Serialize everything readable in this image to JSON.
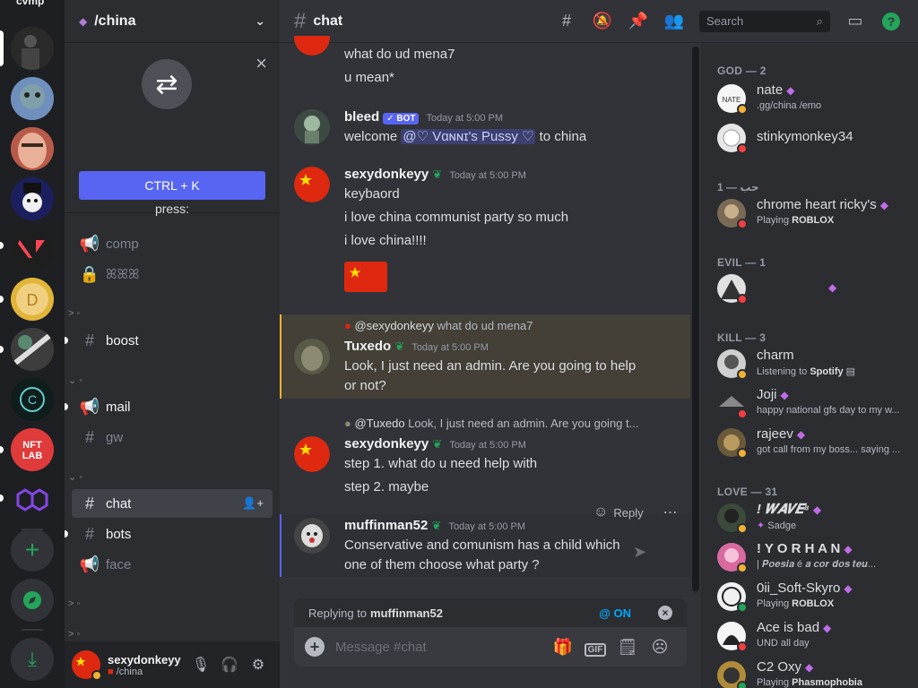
{
  "rail": {
    "top_name": "cvmp"
  },
  "guild": {
    "name": "/china",
    "quick_switcher": {
      "message": "Use Quick Switcher to get around Discord quickly. Just press:",
      "shortcut": "CTRL + K"
    }
  },
  "channels": [
    {
      "name": "comp",
      "icon": "megaphone-icon"
    },
    {
      "name": "ꕤꕤꕤ",
      "icon": "lock-icon"
    },
    {
      "name": "boost",
      "icon": "hash-icon"
    },
    {
      "name": "mail",
      "icon": "megaphone-icon"
    },
    {
      "name": "gw",
      "icon": "hash-icon"
    },
    {
      "name": "chat",
      "icon": "hash-icon"
    },
    {
      "name": "bots",
      "icon": "hash-icon"
    },
    {
      "name": "face",
      "icon": "megaphone-icon"
    }
  ],
  "categories": [
    "> ◦",
    "⌄ ◦",
    "⌄ ◦",
    "> ◦",
    "> ◦"
  ],
  "user_panel": {
    "username": "sexydonkeyy",
    "status": "/china"
  },
  "chat": {
    "channel": "chat",
    "search_placeholder": "Search",
    "messages": {
      "m0": {
        "line1": "what do ud mena7",
        "line2": "u mean*"
      },
      "m1": {
        "author": "bleed",
        "badge": "✓ BOT",
        "time": "Today at 5:00 PM",
        "pre": "welcome",
        "mention": "@♡ Vɑɴɴɪ's Pussy ♡",
        "post": "to china"
      },
      "m2": {
        "author": "sexydonkeyy",
        "time": "Today at 5:00 PM",
        "lines": [
          "keybaord",
          "i love china communist party so much",
          "i love china!!!!"
        ]
      },
      "m3": {
        "reply_author": "@sexydonkeyy",
        "reply_text": "what do ud mena7",
        "author": "Tuxedo",
        "time": "Today at 5:00 PM",
        "line1": "Look, I just need an admin. Are you going to help",
        "line2": "or not?"
      },
      "m4": {
        "reply_author": "@Tuxedo",
        "reply_text": "Look, I just need an admin. Are you going t...",
        "author": "sexydonkeyy",
        "time": "Today at 5:00 PM",
        "line1": "step 1. what do u need help with",
        "line2": "step 2. maybe"
      },
      "m5": {
        "author": "muffinman52",
        "time": "Today at 5:00 PM",
        "line1": "Conservative and comunism has a child which",
        "line2": "one of them choose what party ?",
        "hover_reply": "Reply"
      }
    },
    "replying_to_label": "Replying to",
    "replying_to_user": "muffinman52",
    "mention_toggle": "@ ON",
    "composer_placeholder": "Message #chat",
    "gif_label": "GIF"
  },
  "members": {
    "roles": [
      {
        "name": "GOD — 2"
      },
      {
        "name": "1 — حب"
      },
      {
        "name": "EVIL — 1"
      },
      {
        "name": "KILL — 3"
      },
      {
        "name": "LOVE — 31"
      }
    ],
    "list": [
      {
        "name": "nate",
        "sub": ".gg/china /emo",
        "status": "idle",
        "color": "#ffffff"
      },
      {
        "name": "stinkymonkey34",
        "sub": "",
        "status": "dnd",
        "color": "#e6e6e6"
      },
      {
        "name": "chrome heart ricky's",
        "sub_pre": "Playing",
        "sub_bold": "ROBLOX",
        "status": "dnd",
        "color": "#7a6a55"
      },
      {
        "name": "",
        "sub": "",
        "status": "dnd",
        "color": "#e0e0e0"
      },
      {
        "name": "charm",
        "sub_pre": "Listening to",
        "sub_bold": "Spotify",
        "status": "idle",
        "color": "#cfcfcf"
      },
      {
        "name": "Joji",
        "sub": "happy national gfs day to my w...",
        "status": "dnd",
        "color": "#555555"
      },
      {
        "name": "rajeev",
        "sub": "got call from my boss... saying ...",
        "status": "idle",
        "color": "#6b5a3a"
      },
      {
        "name": "! 𝑾𝑨𝑽𝑬⁸",
        "sub": "Sadge",
        "status": "idle",
        "color": "#3b4a3b"
      },
      {
        "name": "! Y O R H A N",
        "sub": "| 𝑷𝒐𝒆𝒔𝒊𝒂 é 𝒂 𝒄𝒐𝒓 𝒅𝒐𝒔 𝒕𝒆𝒖...",
        "status": "idle",
        "color": "#d96aa0"
      },
      {
        "name": "0ii_Soft-Skyro",
        "sub_pre": "Playing",
        "sub_bold": "ROBLOX",
        "status": "online",
        "color": "#f0f0f0"
      },
      {
        "name": "Ace is bad",
        "sub": "UND all day",
        "status": "dnd",
        "color": "#f5f5f5"
      },
      {
        "name": "C2 Oxy",
        "sub_pre": "Playing",
        "sub_bold": "Phasmophobia",
        "status": "online",
        "color": "#b08b3a"
      }
    ]
  },
  "colors": {
    "accent": "#5865f2",
    "online": "#23a55a",
    "idle": "#f0b232",
    "dnd": "#f23f43",
    "china_red": "#de2910",
    "china_star": "#ffde00"
  }
}
